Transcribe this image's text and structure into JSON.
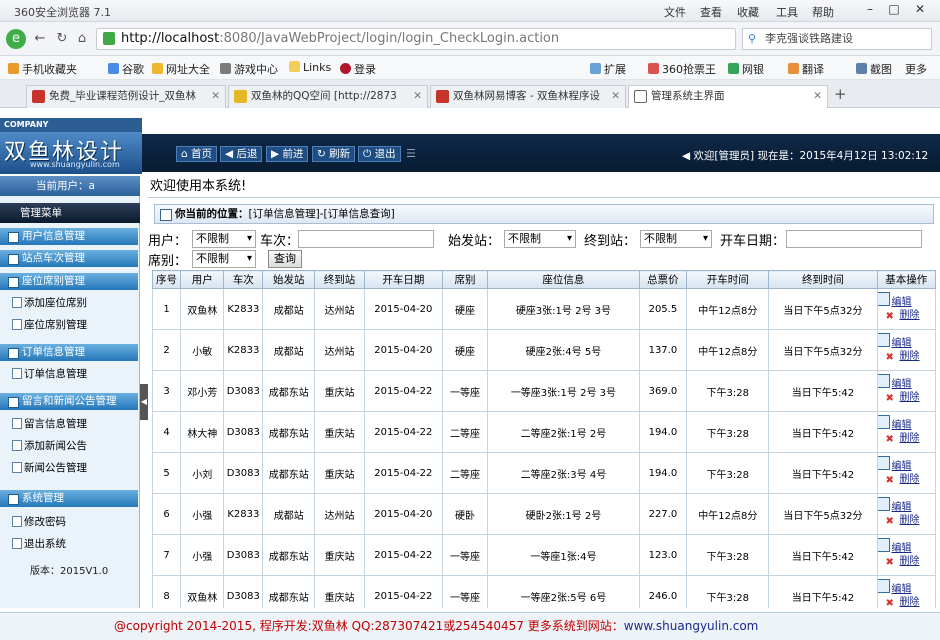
{
  "browser": {
    "app_title": "360安全浏览器 7.1",
    "menus": [
      "文件",
      "查看",
      "收藏",
      "工具",
      "帮助"
    ],
    "url_host": "http://localhost",
    "url_path": ":8080/JavaWebProject/login/login_CheckLogin.action",
    "search_text": "李克强谈铁路建设",
    "bookmarks": [
      "手机收藏夹",
      "谷歌",
      "网址大全",
      "游戏中心",
      "Links",
      "登录",
      "扩展",
      "360抢票王",
      "网银",
      "翻译",
      "截图",
      "更多"
    ],
    "tabs": [
      "免费_毕业课程范例设计_双鱼林",
      "双鱼林的QQ空间 [http://2873",
      "双鱼林网易博客 - 双鱼林程序设",
      "管理系统主界面"
    ],
    "colors": {
      "active_tab": "#ffffff",
      "nav_bg": "#0e2948",
      "menu_group": "#2577b8"
    }
  },
  "header": {
    "company": "COMPANY",
    "logo_name": "双鱼林设计",
    "logo_url": "www.shuangyulin.com",
    "nav": [
      "首页",
      "后退",
      "前进",
      "刷新",
      "退出"
    ],
    "welcome": "欢迎[管理员]  现在是：2015年4月12日  13:02:12"
  },
  "sidebar": {
    "current_user": "当前用户：a",
    "menu_header": "管理菜单",
    "groups": [
      {
        "label": "用户信息管理"
      },
      {
        "label": "站点车次管理"
      },
      {
        "label": "座位席别管理",
        "items": [
          "添加座位席别",
          "座位席别管理"
        ]
      },
      {
        "label": "订单信息管理",
        "items": [
          "订单信息管理"
        ]
      },
      {
        "label": "留言和新闻公告管理",
        "items": [
          "留言信息管理",
          "添加新闻公告",
          "新闻公告管理"
        ]
      },
      {
        "label": "系统管理",
        "items": [
          "修改密码",
          "退出系统"
        ]
      }
    ],
    "version": "版本：2015V1.0"
  },
  "main": {
    "welcome": "欢迎使用本系统!",
    "location_label": "你当前的位置：",
    "location": "[订单信息管理]-[订单信息查询]",
    "filters": {
      "user_label": "用户：",
      "user_value": "不限制",
      "train_label": "车次：",
      "start_label": "始发站：",
      "start_value": "不限制",
      "end_label": "终到站：",
      "end_value": "不限制",
      "date_label": "开车日期：",
      "seat_label": "席别：",
      "seat_value": "不限制",
      "query": "查询"
    },
    "columns": [
      "序号",
      "用户",
      "车次",
      "始发站",
      "终到站",
      "开车日期",
      "席别",
      "座位信息",
      "总票价",
      "开车时间",
      "终到时间",
      "基本操作"
    ],
    "rows": [
      [
        "1",
        "双鱼林",
        "K2833",
        "成都站",
        "达州站",
        "2015-04-20",
        "硬座",
        "硬座3张:1号 2号 3号",
        "205.5",
        "中午12点8分",
        "当日下午5点32分"
      ],
      [
        "2",
        "小敏",
        "K2833",
        "成都站",
        "达州站",
        "2015-04-20",
        "硬座",
        "硬座2张:4号 5号",
        "137.0",
        "中午12点8分",
        "当日下午5点32分"
      ],
      [
        "3",
        "邓小芳",
        "D3083",
        "成都东站",
        "重庆站",
        "2015-04-22",
        "一等座",
        "一等座3张:1号 2号 3号",
        "369.0",
        "下午3:28",
        "当日下午5:42"
      ],
      [
        "4",
        "林大神",
        "D3083",
        "成都东站",
        "重庆站",
        "2015-04-22",
        "二等座",
        "二等座2张:1号 2号",
        "194.0",
        "下午3:28",
        "当日下午5:42"
      ],
      [
        "5",
        "小刘",
        "D3083",
        "成都东站",
        "重庆站",
        "2015-04-22",
        "二等座",
        "二等座2张:3号 4号",
        "194.0",
        "下午3:28",
        "当日下午5:42"
      ],
      [
        "6",
        "小强",
        "K2833",
        "成都站",
        "达州站",
        "2015-04-20",
        "硬卧",
        "硬卧2张:1号 2号",
        "227.0",
        "中午12点8分",
        "当日下午5点32分"
      ],
      [
        "7",
        "小强",
        "D3083",
        "成都东站",
        "重庆站",
        "2015-04-22",
        "一等座",
        "一等座1张:4号",
        "123.0",
        "下午3:28",
        "当日下午5:42"
      ],
      [
        "8",
        "双鱼林",
        "D3083",
        "成都东站",
        "重庆站",
        "2015-04-22",
        "一等座",
        "一等座2张:5号 6号",
        "246.0",
        "下午3:28",
        "当日下午5:42"
      ]
    ],
    "edit_label": "编辑",
    "delete_label": "删除"
  },
  "footer": {
    "copyright": "@copyright 2014-2015, 程序开发:双鱼林  QQ:287307421或254540457  更多系统到网站：",
    "site": "www.shuangyulin.com"
  }
}
